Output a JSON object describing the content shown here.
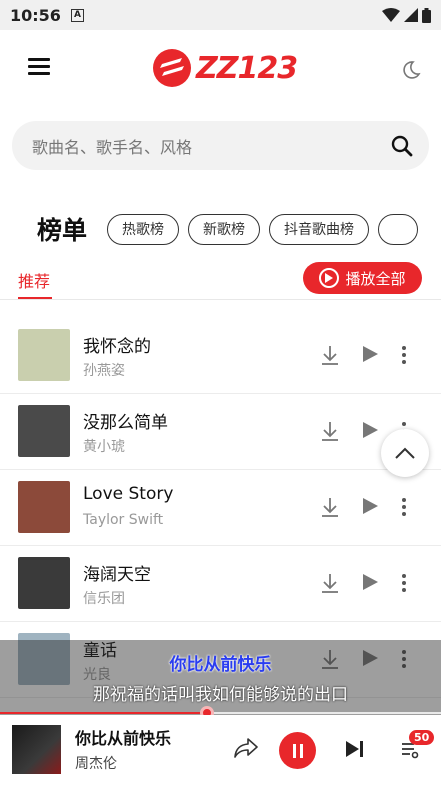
{
  "status": {
    "time": "10:56",
    "app_icon": "A"
  },
  "header": {
    "logo_text": "ZZ123"
  },
  "search": {
    "placeholder": "歌曲名、歌手名、风格"
  },
  "charts": {
    "title": "榜单",
    "chips": [
      "热歌榜",
      "新歌榜",
      "抖音歌曲榜"
    ]
  },
  "tabs": {
    "active": "推荐",
    "play_all": "播放全部"
  },
  "songs": [
    {
      "title": "我怀念的",
      "artist": "孙燕姿",
      "cover_color": "#c9cfae"
    },
    {
      "title": "没那么简单",
      "artist": "黄小琥",
      "cover_color": "#4a4a4a"
    },
    {
      "title": "Love Story",
      "artist": "Taylor Swift",
      "cover_color": "#8c4a3a"
    },
    {
      "title": "海阔天空",
      "artist": "信乐团",
      "cover_color": "#3a3a3a"
    },
    {
      "title": "童话",
      "artist": "光良",
      "cover_color": "#9fb3c0"
    }
  ],
  "lyrics": {
    "current": "你比从前快乐",
    "next": "那祝福的话叫我如何能够说的出口"
  },
  "player": {
    "title": "你比从前快乐",
    "artist": "周杰伦",
    "progress": 0.47,
    "queue_count": "50"
  },
  "colors": {
    "accent": "#e8272b"
  }
}
